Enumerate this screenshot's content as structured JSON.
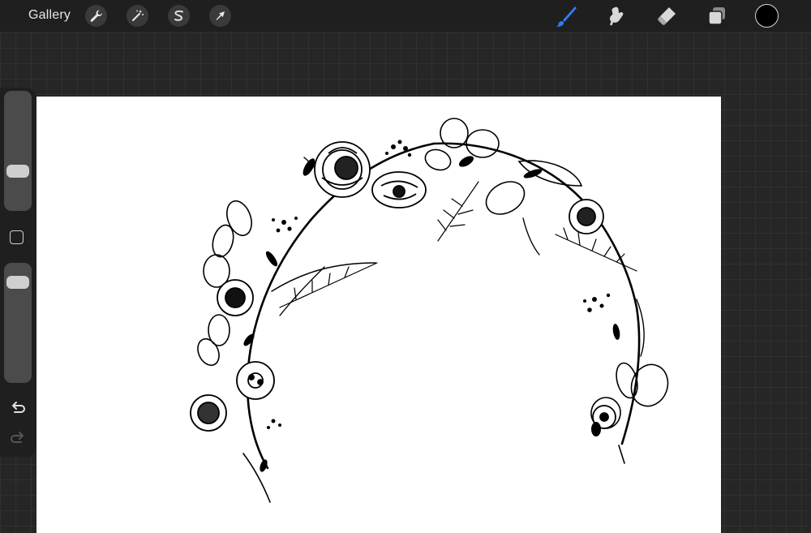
{
  "topbar": {
    "gallery_label": "Gallery",
    "left_tools": [
      "wrench-icon",
      "magic-wand-icon",
      "selection-icon",
      "transform-arrow-icon"
    ],
    "right_tools": [
      "brush-icon",
      "smudge-icon",
      "eraser-icon",
      "layers-icon"
    ],
    "active_tool": "brush-icon",
    "active_color": "#2f7df6",
    "current_color": "#000000"
  },
  "sidebar": {
    "brush_size": 0.3,
    "opacity": 0.9
  },
  "canvas": {
    "background": "#ffffff"
  }
}
